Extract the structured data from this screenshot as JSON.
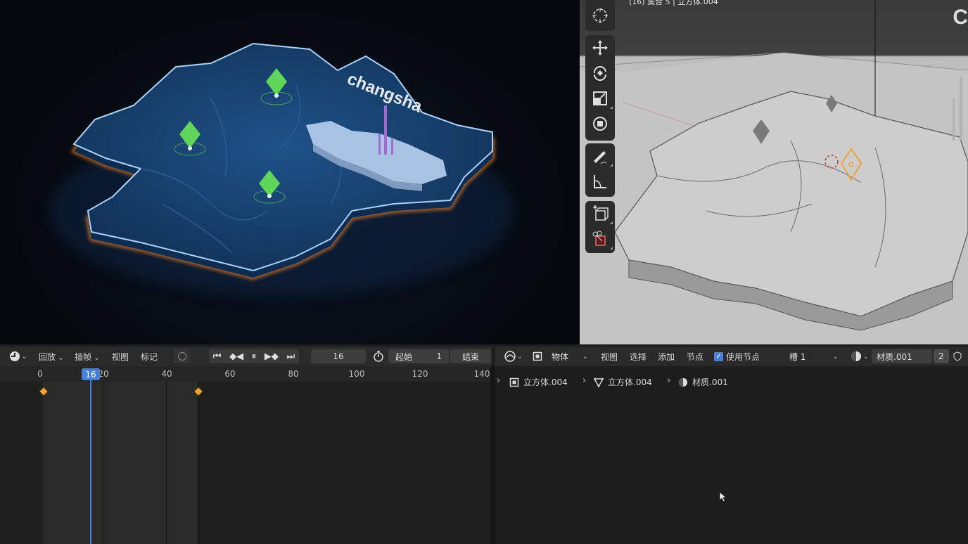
{
  "render": {
    "map_label": "changsha"
  },
  "viewport3d": {
    "header_text": "(16) 集合 5 | 立方体.004",
    "corner_logo": "C",
    "tools": [
      "cursor-icon",
      "move-icon",
      "rotate-icon",
      "scale-icon",
      "transform-icon",
      "annotate-icon",
      "measure-icon",
      "add-cube-icon",
      "scissors-cube-icon"
    ]
  },
  "timeline_header": {
    "editor_icon": "clock-icon",
    "playback": "回放",
    "keying": "插帧",
    "view": "视图",
    "marker": "标记",
    "current_frame": "16",
    "start_label": "起始",
    "start_value": "1",
    "end_label": "结束"
  },
  "timeline": {
    "current_frame": 16,
    "ticks": [
      "0",
      "20",
      "40",
      "60",
      "80",
      "100",
      "120",
      "140"
    ],
    "playhead_label": "16",
    "keyframes": [
      1,
      50
    ],
    "range": [
      1,
      50
    ]
  },
  "shader_header": {
    "editor_icon": "shader-icon",
    "object_mode": "物体",
    "view": "视图",
    "select": "选择",
    "add": "添加",
    "node": "节点",
    "use_nodes_label": "使用节点",
    "use_nodes_checked": true,
    "slot": "槽 1",
    "material": "材质.001",
    "user_count": "2"
  },
  "breadcrumb": {
    "object": "立方体.004",
    "mesh": "立方体.004",
    "material": "材质.001"
  },
  "colors": {
    "accent_blue": "#4a7fd6",
    "keyframe": "#e9a43a",
    "map_fill": "#17406e",
    "glow_orange": "#ff8a2a",
    "pin_green": "#5fd55a"
  }
}
